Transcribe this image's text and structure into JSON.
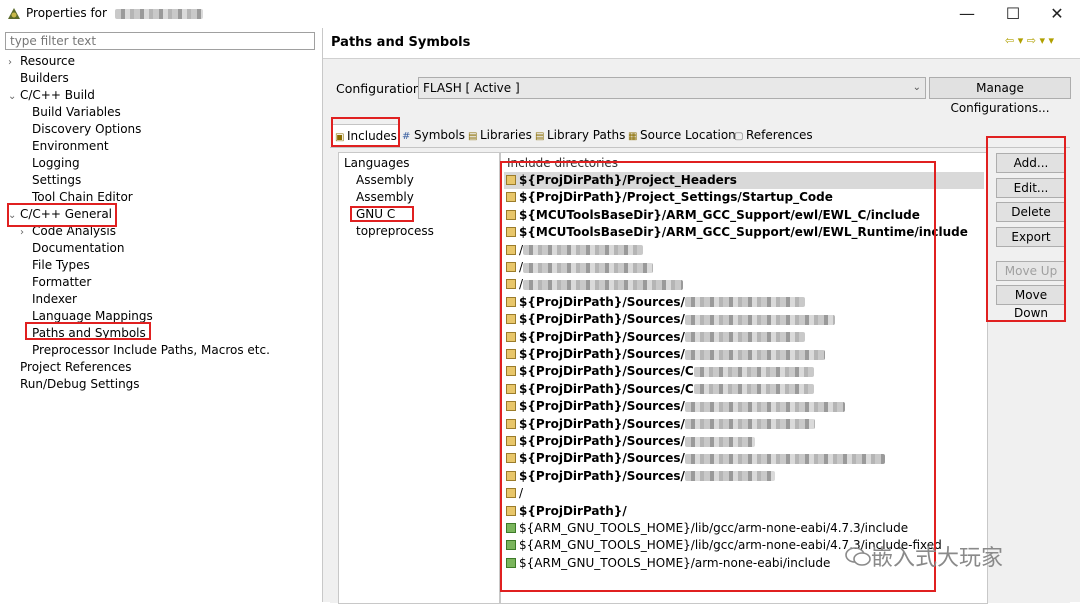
{
  "window": {
    "title": "Properties for",
    "controls": [
      "—",
      "☐",
      "✕"
    ]
  },
  "filter": {
    "placeholder": "type filter text"
  },
  "tree": [
    {
      "label": "Resource",
      "indent": 0,
      "twisty": "›"
    },
    {
      "label": "Builders",
      "indent": 0,
      "twisty": ""
    },
    {
      "label": "C/C++ Build",
      "indent": 0,
      "twisty": "⌄"
    },
    {
      "label": "Build Variables",
      "indent": 1,
      "twisty": ""
    },
    {
      "label": "Discovery Options",
      "indent": 1,
      "twisty": ""
    },
    {
      "label": "Environment",
      "indent": 1,
      "twisty": ""
    },
    {
      "label": "Logging",
      "indent": 1,
      "twisty": ""
    },
    {
      "label": "Settings",
      "indent": 1,
      "twisty": ""
    },
    {
      "label": "Tool Chain Editor",
      "indent": 1,
      "twisty": ""
    },
    {
      "label": "C/C++ General",
      "indent": 0,
      "twisty": "⌄"
    },
    {
      "label": "Code Analysis",
      "indent": 1,
      "twisty": "›"
    },
    {
      "label": "Documentation",
      "indent": 1,
      "twisty": ""
    },
    {
      "label": "File Types",
      "indent": 1,
      "twisty": ""
    },
    {
      "label": "Formatter",
      "indent": 1,
      "twisty": ""
    },
    {
      "label": "Indexer",
      "indent": 1,
      "twisty": ""
    },
    {
      "label": "Language Mappings",
      "indent": 1,
      "twisty": ""
    },
    {
      "label": "Paths and Symbols",
      "indent": 1,
      "twisty": ""
    },
    {
      "label": "Preprocessor Include Paths, Macros etc.",
      "indent": 1,
      "twisty": ""
    },
    {
      "label": "Project References",
      "indent": 0,
      "twisty": ""
    },
    {
      "label": "Run/Debug Settings",
      "indent": 0,
      "twisty": ""
    }
  ],
  "page": {
    "title": "Paths and Symbols",
    "nav": "⇦ ▾ ⇨ ▾ ▾"
  },
  "configuration": {
    "label": "Configuration:",
    "value": "FLASH  [ Active ]",
    "manage_label": "Manage Configurations..."
  },
  "tabs": [
    "Includes",
    "Symbols",
    "Libraries",
    "Library Paths",
    "Source Location",
    "References"
  ],
  "languages": {
    "header": "Languages",
    "items": [
      "Assembly",
      "Assembly",
      "GNU C",
      "topreprocess"
    ]
  },
  "includes": {
    "header": "Include directories",
    "rows": [
      {
        "text": "${ProjDirPath}/Project_Headers",
        "bold": true,
        "kind": "ws"
      },
      {
        "text": "${ProjDirPath}/Project_Settings/Startup_Code",
        "bold": true,
        "kind": "ws"
      },
      {
        "text": "${MCUToolsBaseDir}/ARM_GCC_Support/ewl/EWL_C/include",
        "bold": true,
        "kind": "ws"
      },
      {
        "text": "${MCUToolsBaseDir}/ARM_GCC_Support/ewl/EWL_Runtime/include",
        "bold": true,
        "kind": "ws"
      },
      {
        "text": "/",
        "bold": false,
        "kind": "ws"
      },
      {
        "text": "/",
        "bold": false,
        "kind": "ws"
      },
      {
        "text": "/",
        "bold": false,
        "kind": "ws"
      },
      {
        "text": "${ProjDirPath}/Sources/",
        "bold": true,
        "kind": "ws"
      },
      {
        "text": "${ProjDirPath}/Sources/",
        "bold": true,
        "kind": "ws"
      },
      {
        "text": "${ProjDirPath}/Sources/",
        "bold": true,
        "kind": "ws"
      },
      {
        "text": "${ProjDirPath}/Sources/",
        "bold": true,
        "kind": "ws"
      },
      {
        "text": "${ProjDirPath}/Sources/C",
        "bold": true,
        "kind": "ws"
      },
      {
        "text": "${ProjDirPath}/Sources/C",
        "bold": true,
        "kind": "ws"
      },
      {
        "text": "${ProjDirPath}/Sources/",
        "bold": true,
        "kind": "ws"
      },
      {
        "text": "${ProjDirPath}/Sources/",
        "bold": true,
        "kind": "ws"
      },
      {
        "text": "${ProjDirPath}/Sources/",
        "bold": true,
        "kind": "ws"
      },
      {
        "text": "${ProjDirPath}/Sources/",
        "bold": true,
        "kind": "ws"
      },
      {
        "text": "${ProjDirPath}/Sources/",
        "bold": true,
        "kind": "ws"
      },
      {
        "text": "/",
        "bold": false,
        "kind": "ws"
      },
      {
        "text": "${ProjDirPath}/",
        "bold": true,
        "kind": "ws"
      },
      {
        "text": "${ARM_GNU_TOOLS_HOME}/lib/gcc/arm-none-eabi/4.7.3/include",
        "bold": false,
        "kind": "env"
      },
      {
        "text": "${ARM_GNU_TOOLS_HOME}/lib/gcc/arm-none-eabi/4.7.3/include-fixed",
        "bold": false,
        "kind": "env"
      },
      {
        "text": "${ARM_GNU_TOOLS_HOME}/arm-none-eabi/include",
        "bold": false,
        "kind": "env"
      }
    ]
  },
  "buttons": {
    "add": "Add...",
    "edit": "Edit...",
    "delete": "Delete",
    "export": "Export",
    "move_up": "Move Up",
    "move_down": "Move Down"
  },
  "watermark": "嵌入式大玩家",
  "colors": {
    "highlight": "#e02020",
    "selection": "#d9d9d9",
    "folder": "#e8c66a"
  }
}
